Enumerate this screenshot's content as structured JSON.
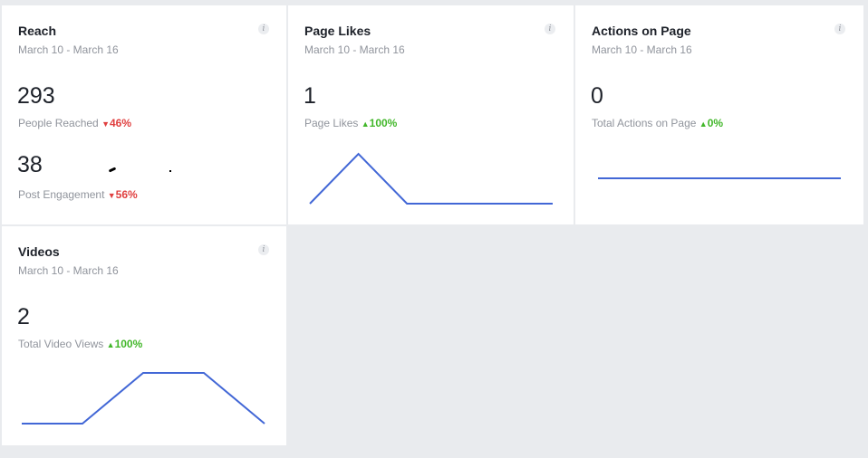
{
  "reach": {
    "title": "Reach",
    "date_range": "March 10 - March 16",
    "people_reached": {
      "value": "293",
      "label": "People Reached",
      "trend_arrow": "▼",
      "trend_text": "46%"
    },
    "post_engagement": {
      "value": "38",
      "label": "Post Engagement",
      "trend_arrow": "▼",
      "trend_text": "56%"
    }
  },
  "page_likes": {
    "title": "Page Likes",
    "date_range": "March 10 - March 16",
    "value": "1",
    "label": "Page Likes",
    "trend_arrow": "▲",
    "trend_text": "100%",
    "sparkline": [
      0,
      1,
      0,
      0,
      0,
      0
    ]
  },
  "actions_on_page": {
    "title": "Actions on Page",
    "date_range": "March 10 - March 16",
    "value": "0",
    "label": "Total Actions on Page",
    "trend_arrow": "▲",
    "trend_text": "0%",
    "sparkline": [
      0,
      0,
      0,
      0,
      0,
      0
    ]
  },
  "videos": {
    "title": "Videos",
    "date_range": "March 10 - March 16",
    "value": "2",
    "label": "Total Video Views",
    "trend_arrow": "▲",
    "trend_text": "100%",
    "sparkline": [
      0,
      0,
      1,
      1,
      0
    ]
  },
  "info_icon_glyph": "i",
  "colors": {
    "sparkline": "#4267d6",
    "trend_down": "#e03f3f",
    "trend_up": "#42b72a"
  }
}
